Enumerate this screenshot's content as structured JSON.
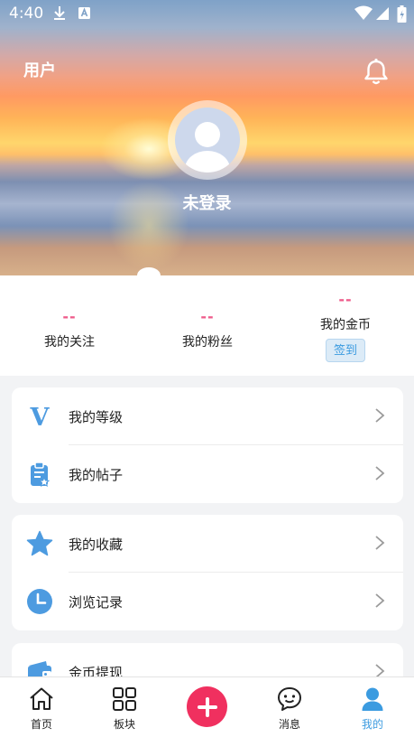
{
  "status_bar": {
    "time": "4:40"
  },
  "header": {
    "title": "用户",
    "username": "未登录"
  },
  "stats": [
    {
      "value": "--",
      "label": "我的关注"
    },
    {
      "value": "--",
      "label": "我的粉丝"
    },
    {
      "value": "--",
      "label": "我的金币",
      "action": "签到"
    }
  ],
  "menu_groups": [
    [
      {
        "label": "我的等级",
        "icon": "level-v-icon"
      },
      {
        "label": "我的帖子",
        "icon": "clipboard-icon"
      }
    ],
    [
      {
        "label": "我的收藏",
        "icon": "star-icon"
      },
      {
        "label": "浏览记录",
        "icon": "clock-icon"
      }
    ],
    [
      {
        "label": "金币提现",
        "icon": "wallet-icon"
      }
    ]
  ],
  "tabs": [
    {
      "label": "首页",
      "icon": "home-icon"
    },
    {
      "label": "板块",
      "icon": "grid-icon"
    },
    {
      "label": "",
      "icon": "plus-icon"
    },
    {
      "label": "消息",
      "icon": "message-icon"
    },
    {
      "label": "我的",
      "icon": "person-icon",
      "active": true
    }
  ],
  "colors": {
    "accent": "#3b9be0",
    "pink": "#ef5a8a",
    "fab": "#f0305f"
  }
}
